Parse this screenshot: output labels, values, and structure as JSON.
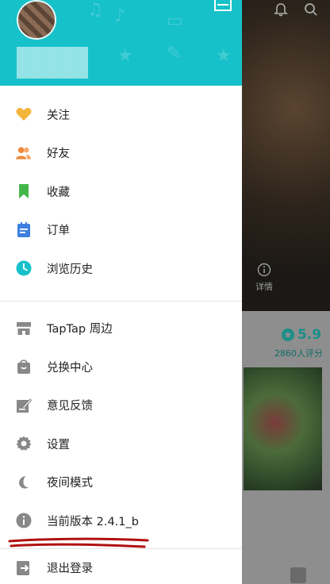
{
  "drawer": {
    "primary_items": [
      {
        "label": "关注",
        "icon": "heart-icon",
        "color": "#f5b43a"
      },
      {
        "label": "好友",
        "icon": "friends-icon",
        "color": "#f08a3c"
      },
      {
        "label": "收藏",
        "icon": "bookmark-icon",
        "color": "#43b649"
      },
      {
        "label": "订单",
        "icon": "order-icon",
        "color": "#3d7fe0"
      },
      {
        "label": "浏览历史",
        "icon": "clock-icon",
        "color": "#17c1c9"
      }
    ],
    "secondary_items": [
      {
        "label": "TapTap 周边",
        "icon": "store-icon"
      },
      {
        "label": "兑换中心",
        "icon": "shopping-bag-icon"
      },
      {
        "label": "意见反馈",
        "icon": "feedback-icon"
      },
      {
        "label": "设置",
        "icon": "gear-icon"
      },
      {
        "label": "夜间模式",
        "icon": "moon-icon"
      },
      {
        "label": "当前版本 2.4.1_b",
        "icon": "info-icon"
      }
    ],
    "logout_label": "退出登录",
    "header_color": "#17c1c9"
  },
  "background": {
    "info_label": "详情",
    "rating": "5.9",
    "rating_count": "2860人评分"
  }
}
